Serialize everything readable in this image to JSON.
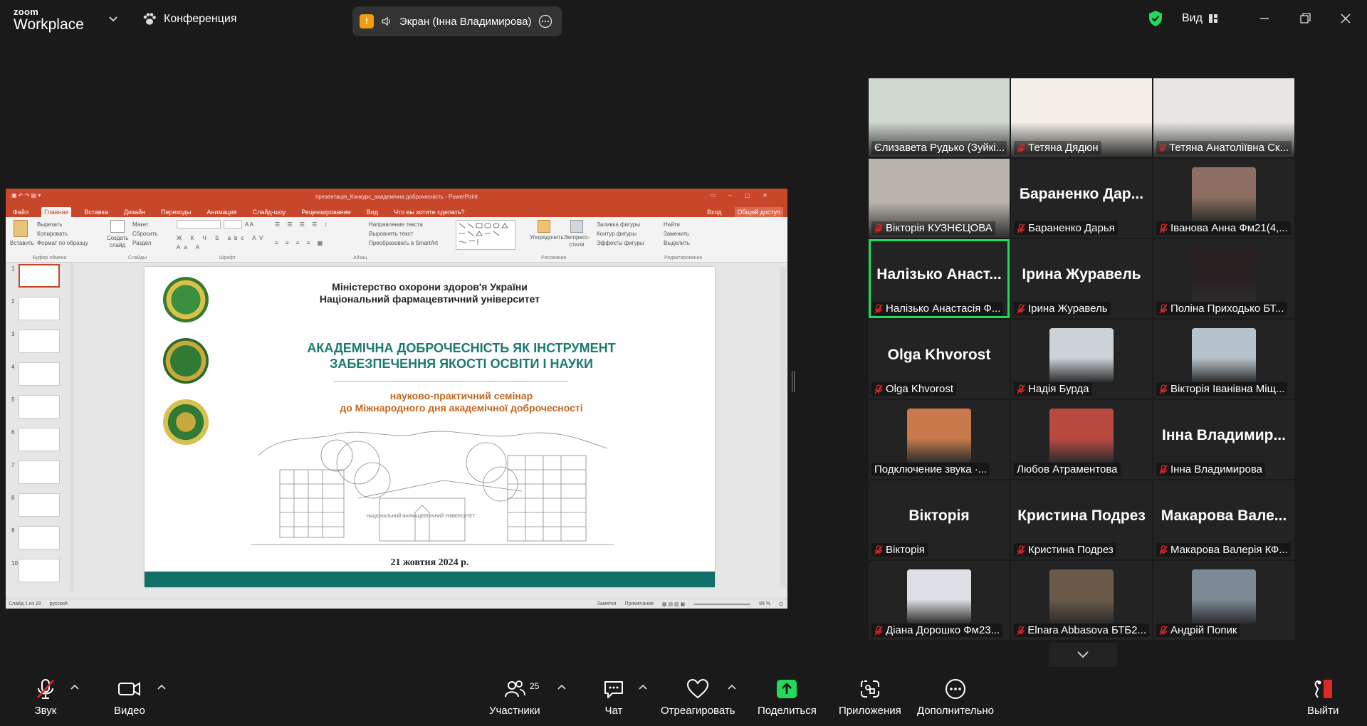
{
  "topbar": {
    "brand_top": "zoom",
    "brand_bottom": "Workplace",
    "meeting_label": "Конференция",
    "share_indicator": "!",
    "share_text": "Экран (Інна Владимирова)",
    "view_label": "Вид"
  },
  "ppt": {
    "window_title": "презентація_Конкурс_академічна доброчесність - PowerPoint",
    "tabs": [
      "Файл",
      "Главная",
      "Вставка",
      "Дизайн",
      "Переходы",
      "Анимация",
      "Слайд-шоу",
      "Рецензирование",
      "Вид",
      "Что вы хотите сделать?"
    ],
    "signin": "Вход",
    "share": "Общий доступ",
    "ribbon": {
      "paste": "Вставить",
      "cut": "Вырезать",
      "copy": "Копировать",
      "format_painter": "Формат по образцу",
      "clipboard_group": "Буфер обмена",
      "new_slide": "Создать слайд",
      "layout": "Макет",
      "reset": "Сбросить",
      "section": "Раздел",
      "slides_group": "Слайды",
      "font_group": "Шрифт",
      "paragraph_group": "Абзац",
      "text_direction": "Направление текста",
      "align_text": "Выровнять текст",
      "smartart": "Преобразовать в SmartArt",
      "arrange": "Упорядочить",
      "quick_styles": "Экспресс-стили",
      "shape_fill": "Заливка фигуры",
      "shape_outline": "Контур фигуры",
      "shape_effects": "Эффекты фигуры",
      "drawing_group": "Рисование",
      "find": "Найти",
      "replace": "Заменить",
      "select": "Выделить",
      "editing_group": "Редактирование"
    },
    "thumb_numbers": [
      "1",
      "2",
      "3",
      "4",
      "5",
      "6",
      "7",
      "8",
      "9",
      "10"
    ],
    "slide": {
      "ministry_line1": "Міністерство охорони здоров'я України",
      "ministry_line2": "Національний фармацевтичний університет",
      "title_line1": "АКАДЕМІЧНА ДОБРОЧЕСНІСТЬ ЯК ІНСТРУМЕНТ",
      "title_line2": "ЗАБЕЗПЕЧЕННЯ ЯКОСТІ ОСВІТИ І НАУКИ",
      "subtitle_line1": "науково-практичний семінар",
      "subtitle_line2": "до Міжнародного дня академічної доброчесності",
      "building_sign": "НАЦІОНАЛЬНИЙ ФАРМАЦЕВТИЧНИЙ УНІВЕРСИТЕТ",
      "date": "21 жовтня 2024 р."
    },
    "status": {
      "slide_count": "Слайд 1 из 28",
      "language": "русский",
      "notes": "Заметки",
      "comments": "Примечания",
      "zoom": "88 %"
    }
  },
  "gallery": {
    "tiles": [
      {
        "name": "Єлизавета Рудько (Зуйкі...",
        "big": "",
        "muted": false,
        "video": true,
        "color": "#cfd9cf"
      },
      {
        "name": "Тетяна Дядюн",
        "big": "",
        "muted": true,
        "video": true,
        "color": "#f4f0e8"
      },
      {
        "name": "Тетяна Анатоліївна Ск...",
        "big": "",
        "muted": true,
        "video": true,
        "color": "#e8e6e2"
      },
      {
        "name": "Вікторія КУЗНЄЦОВА",
        "big": "",
        "muted": true,
        "video": true,
        "color": "#b9b4ab"
      },
      {
        "name": "Бараненко Дарья",
        "big": "Бараненко Дар...",
        "muted": true,
        "video": false
      },
      {
        "name": "Іванова Анна Фм21(4,...",
        "big": "",
        "muted": true,
        "video": true,
        "color": "#8f6f63"
      },
      {
        "name": "Налізько Анастасія Ф...",
        "big": "Налізько Анаст...",
        "muted": true,
        "video": false,
        "active": true
      },
      {
        "name": "Ірина Журавель",
        "big": "Ірина Журавель",
        "muted": true,
        "video": false
      },
      {
        "name": "Поліна Приходько БТ...",
        "big": "",
        "muted": true,
        "video": true,
        "color": "#2a2022"
      },
      {
        "name": "Olga Khvorost",
        "big": "Olga Khvorost",
        "muted": true,
        "video": false
      },
      {
        "name": "Надія Бурда",
        "big": "",
        "muted": true,
        "video": true,
        "color": "#cbd3d8"
      },
      {
        "name": "Вікторія Іванівна Міщ...",
        "big": "",
        "muted": true,
        "video": true,
        "color": "#b7c3cc"
      },
      {
        "name": "Подключение звука ·...",
        "big": "",
        "muted": false,
        "video": true,
        "color": "#c87a4c"
      },
      {
        "name": "Любов Атраментова",
        "big": "",
        "muted": false,
        "video": true,
        "color": "#b94a42"
      },
      {
        "name": "Інна Владимирова",
        "big": "Інна Владимир...",
        "muted": true,
        "video": false
      },
      {
        "name": "Вікторія",
        "big": "Вікторія",
        "muted": true,
        "video": false
      },
      {
        "name": "Кристина Подрез",
        "big": "Кристина Подрез",
        "muted": true,
        "video": false
      },
      {
        "name": "Макарова Валерія КФ...",
        "big": "Макарова Вале...",
        "muted": true,
        "video": false
      },
      {
        "name": "Діана Дорошко Фм23...",
        "big": "",
        "muted": true,
        "video": true,
        "color": "#dde1e6"
      },
      {
        "name": "Elnara Abbasova БТБ2...",
        "big": "",
        "muted": true,
        "video": true,
        "color": "#6b5a4a"
      },
      {
        "name": "Андрій Попик",
        "big": "",
        "muted": true,
        "video": true,
        "color": "#7d8a95"
      }
    ]
  },
  "bottombar": {
    "audio": "Звук",
    "video": "Видео",
    "participants": "Участники",
    "participant_count": "25",
    "chat": "Чат",
    "react": "Отреагировать",
    "share": "Поделиться",
    "apps": "Приложения",
    "more": "Дополнительно",
    "leave": "Выйти"
  },
  "colors": {
    "accent_green": "#23d959",
    "ppt_red": "#c8472b",
    "share_orange": "#f29d0f",
    "muted_red": "#e02828"
  }
}
